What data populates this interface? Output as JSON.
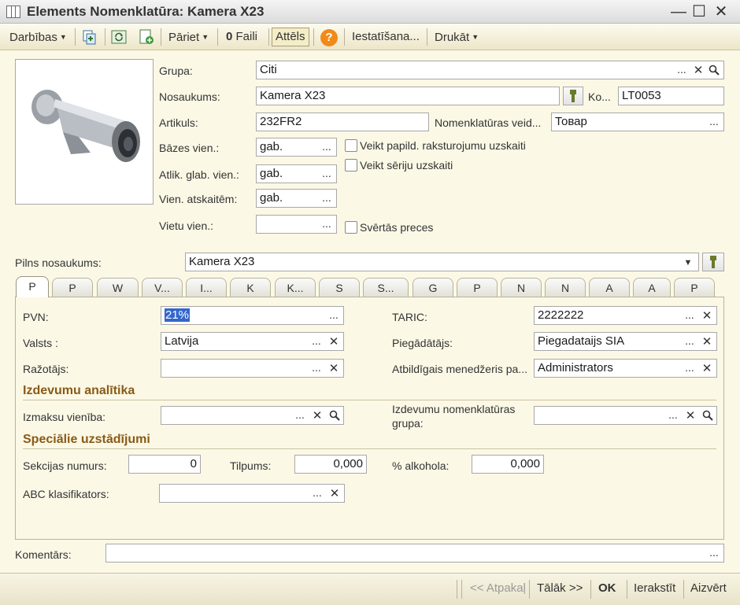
{
  "window": {
    "title": "Elements Nomenklatūra: Kamera X23",
    "minimize": "—",
    "maximize": "☐",
    "close": "✕"
  },
  "toolbar": {
    "actions": "Darbības",
    "goto": "Pāriet",
    "files": "Faili",
    "image": "Attēls",
    "help": "?",
    "settings": "Iestatīšana...",
    "print": "Drukāt"
  },
  "header": {
    "group_label": "Grupa:",
    "group_value": "Citi",
    "name_label": "Nosaukums:",
    "name_value": "Kamera X23",
    "code_label": "Ko...",
    "code_value": "LT0053",
    "article_label": "Artikuls:",
    "article_value": "232FR2",
    "nomtype_label": "Nomenklatūras veid...",
    "nomtype_value": "Товар",
    "base_unit_label": "Bāzes vien.:",
    "base_unit_value": "gab.",
    "stock_unit_label": "Atlik. glab. vien.:",
    "stock_unit_value": "gab.",
    "report_unit_label": "Vien. atskaitēm:",
    "report_unit_value": "gab.",
    "place_unit_label": "Vietu vien.:",
    "place_unit_value": "",
    "chk_characteristics": "Veikt papild. raksturojumu uzskaiti",
    "chk_series": "Veikt sēriju uzskaiti",
    "chk_weighted": "Svērtās preces",
    "fullname_label": "Pilns nosaukums:",
    "fullname_value": "Kamera X23"
  },
  "tabs": [
    "P",
    "P",
    "W",
    "V...",
    "I...",
    "K",
    "K...",
    "S",
    "S...",
    "G",
    "P",
    "N",
    "N",
    "A",
    "A",
    "P"
  ],
  "panel": {
    "vat_label": "PVN:",
    "vat_value": "21%",
    "taric_label": "TARIC:",
    "taric_value": "2222222",
    "country_label": "Valsts :",
    "country_value": "Latvija",
    "supplier_label": "Piegādātājs:",
    "supplier_value": "Piegadataijs SIA",
    "producer_label": "Ražotājs:",
    "producer_value": "",
    "manager_label": "Atbildīgais menedžeris pa...",
    "manager_value": "Administrators",
    "costs_title": "Izdevumu analītika",
    "cost_unit_label": "Izmaksu vienība:",
    "cost_unit_value": "",
    "cost_group_label_1": "Izdevumu nomenklatūras",
    "cost_group_label_2": "grupa:",
    "cost_group_value": "",
    "special_title": "Speciālie uzstādījumi",
    "section_label": "Sekcijas numurs:",
    "section_value": "0",
    "volume_label": "Tilpums:",
    "volume_value": "0,000",
    "alcohol_label": "% alkohola:",
    "alcohol_value": "0,000",
    "abc_label": "ABC klasifikators:",
    "abc_value": ""
  },
  "comment": {
    "label": "Komentārs:",
    "value": ""
  },
  "bottom": {
    "back": "<< Atpakaļ",
    "next": "Tālāk >>",
    "ok": "OK",
    "save": "Ierakstīt",
    "close": "Aizvērt"
  },
  "icons": {
    "ellipsis": "...",
    "clear": "✕",
    "search": "search-icon",
    "dropdown": "▼"
  }
}
